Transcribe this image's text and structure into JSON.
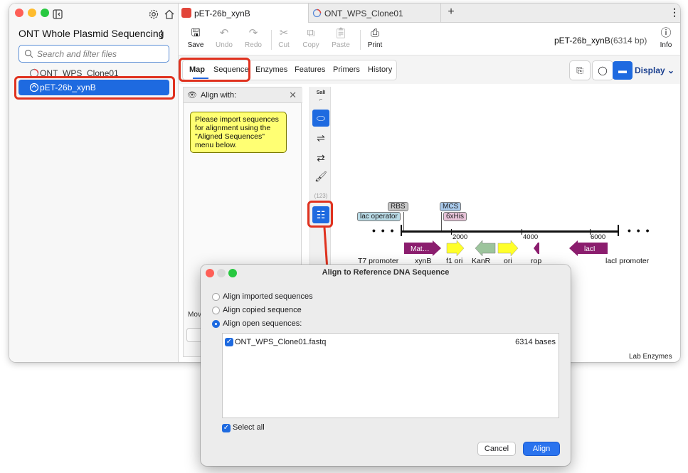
{
  "sidebar": {
    "title": "ONT Whole Plasmid Sequencing",
    "search_placeholder": "Search and filter files",
    "files": [
      {
        "name": "ONT_WPS_Clone01"
      },
      {
        "name": "pET-26b_xynB"
      }
    ]
  },
  "tabs": [
    {
      "label": "pET-26b_xynB",
      "active": true
    },
    {
      "label": "ONT_WPS_Clone01",
      "active": false
    }
  ],
  "toolbar": {
    "save": "Save",
    "undo": "Undo",
    "redo": "Redo",
    "cut": "Cut",
    "copy": "Copy",
    "paste": "Paste",
    "print": "Print",
    "info": "Info",
    "sequence_name": "pET-26b_xynB",
    "sequence_length": "(6314 bp)"
  },
  "view_tabs": [
    "Map",
    "Sequence",
    "Enzymes",
    "Features",
    "Primers",
    "History"
  ],
  "display_label": "Display",
  "align_panel": {
    "title": "Align with:",
    "note": "Please import sequences for alignment using the \"Aligned Sequences\" menu below.",
    "move_label": "Mov"
  },
  "vertical_toolbar": {
    "enzyme_label": "SalI",
    "count_label": "(123)"
  },
  "map": {
    "ticks": [
      "2000",
      "4000",
      "6000"
    ],
    "labels_top": {
      "rbs": "RBS",
      "lac_operator": "lac operator",
      "mcs": "MCS",
      "his": "6xHis"
    },
    "feature_mat": "Mat…",
    "feature_laci": "lacI",
    "features_bottom": [
      "T7 promoter",
      "xynB",
      "f1 ori",
      "KanR",
      "ori",
      "rop",
      "lacI promoter"
    ],
    "colors": {
      "purple": "#8b1d6e",
      "yellow": "#ffff2a",
      "green": "#9cc49c",
      "rbs": "#c8c8c8",
      "lac_operator": "#b9dbe6",
      "mcs": "#a9c9ea",
      "his": "#e7c3d8"
    }
  },
  "footer": {
    "lab_enzymes": "Lab Enzymes"
  },
  "dialog": {
    "title": "Align to Reference DNA Sequence",
    "options": [
      {
        "label": "Align imported sequences",
        "selected": false
      },
      {
        "label": "Align copied sequence",
        "selected": false
      },
      {
        "label": "Align open sequences:",
        "selected": true
      }
    ],
    "list": [
      {
        "name": "ONT_WPS_Clone01.fastq",
        "length": "6314 bases",
        "checked": true
      }
    ],
    "select_all": "Select all",
    "cancel": "Cancel",
    "align": "Align"
  }
}
